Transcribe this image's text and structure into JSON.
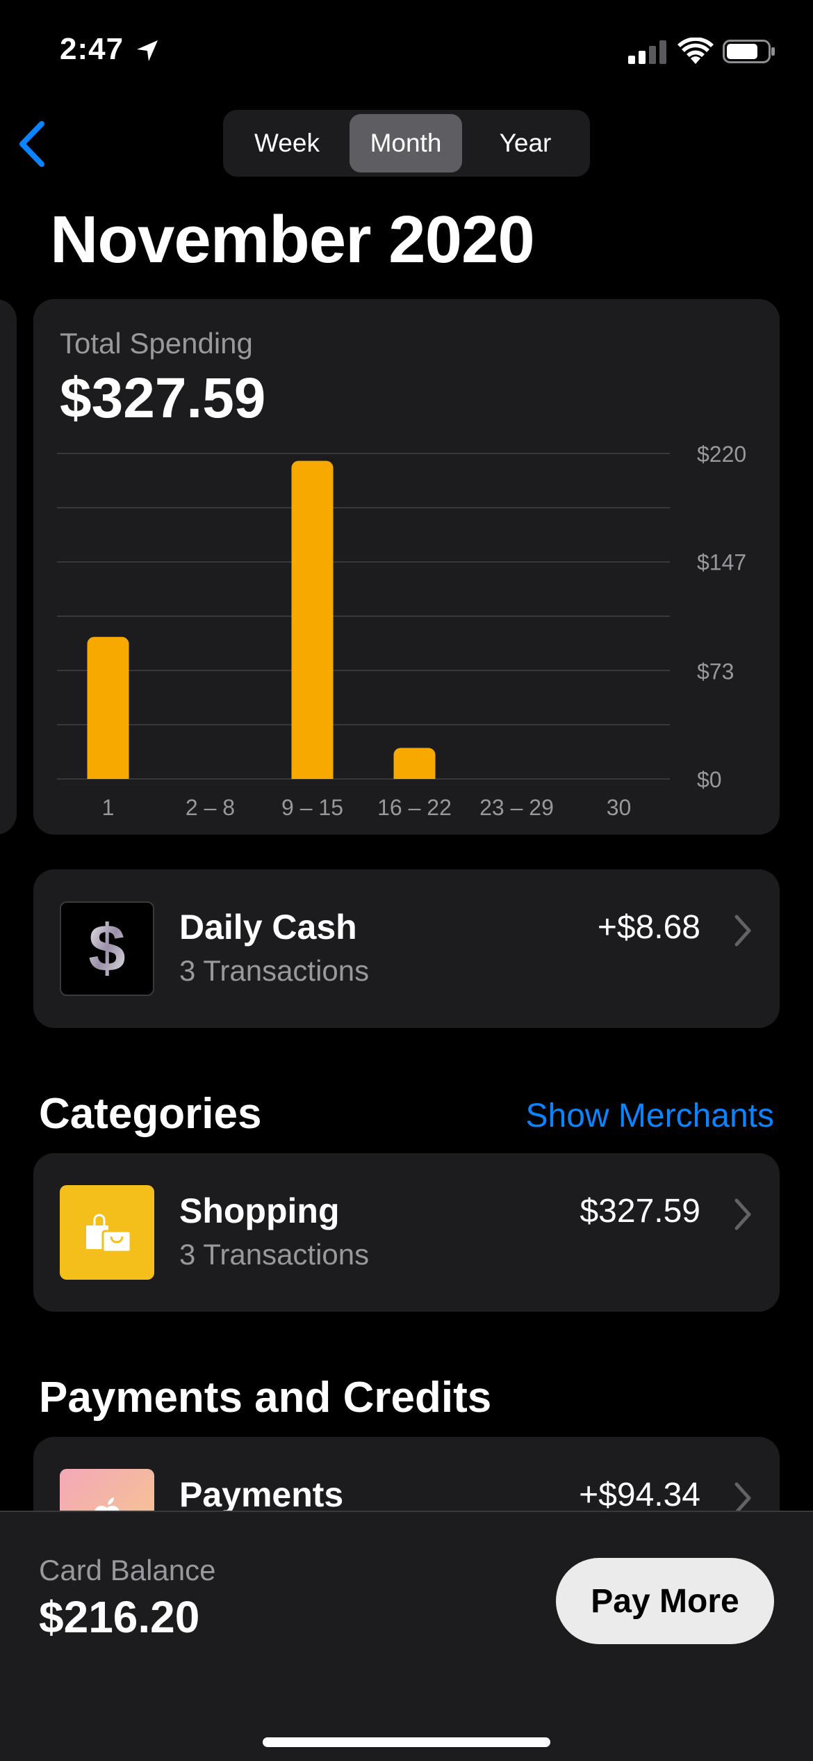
{
  "status_bar": {
    "time": "2:47"
  },
  "segments": {
    "week": "Week",
    "month": "Month",
    "year": "Year",
    "selected": "Month"
  },
  "page_title": "November 2020",
  "spending": {
    "label": "Total Spending",
    "value": "$327.59"
  },
  "chart_data": {
    "type": "bar",
    "categories": [
      "1",
      "2 – 8",
      "9 – 15",
      "16 – 22",
      "23 – 29",
      "30"
    ],
    "values": [
      96,
      0,
      215,
      21,
      0,
      0
    ],
    "ylim": [
      0,
      220
    ],
    "y_ticks": [
      "$220",
      "$147",
      "$73",
      "$0"
    ],
    "y_tick_values": [
      220,
      147,
      73,
      0
    ],
    "bar_color": "#f8a900",
    "grid": true,
    "y_axis_side": "right"
  },
  "daily_cash": {
    "title": "Daily Cash",
    "subtitle": "3 Transactions",
    "amount": "+$8.68"
  },
  "categories": {
    "title": "Categories",
    "show_merchants": "Show Merchants",
    "items": [
      {
        "title": "Shopping",
        "subtitle": "3 Transactions",
        "amount": "$327.59",
        "color": "#f4bf1b"
      }
    ]
  },
  "payments": {
    "title": "Payments and Credits",
    "items": [
      {
        "title": "Payments",
        "amount": "+$94.34"
      }
    ]
  },
  "bottom_bar": {
    "balance_label": "Card Balance",
    "balance_value": "$216.20",
    "pay_button": "Pay More"
  },
  "colors": {
    "accent": "#0a84ff",
    "card": "#1c1c1e",
    "bar": "#f8a900"
  }
}
